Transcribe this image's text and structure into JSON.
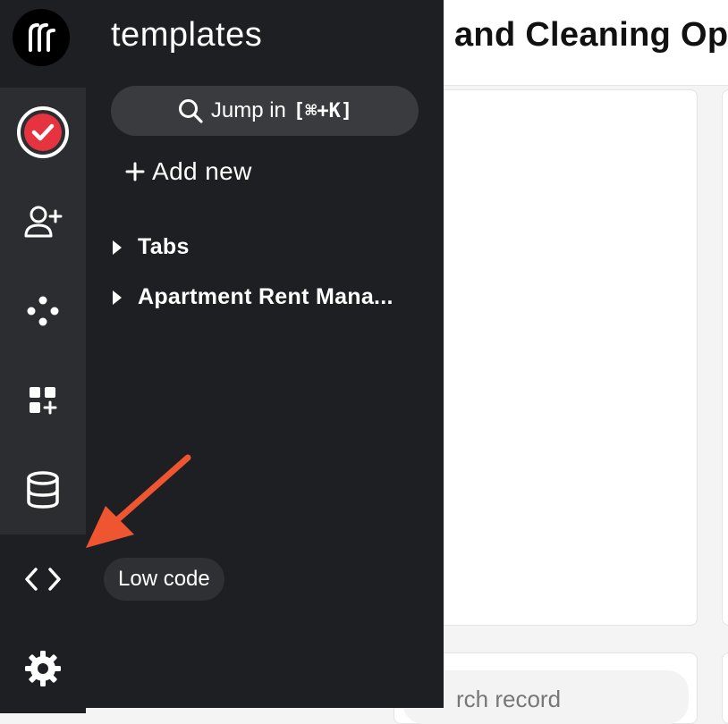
{
  "main": {
    "title": "and Cleaning Op",
    "search_placeholder": "rch record"
  },
  "rail": {
    "logo_icon": "logo-icon",
    "items": [
      {
        "name": "tasks",
        "icon": "check-circle-icon"
      },
      {
        "name": "invite-user",
        "icon": "user-plus-icon"
      },
      {
        "name": "integrations",
        "icon": "nodes-icon"
      },
      {
        "name": "apps",
        "icon": "apps-add-icon"
      },
      {
        "name": "database",
        "icon": "database-icon"
      },
      {
        "name": "low-code",
        "icon": "code-icon"
      },
      {
        "name": "settings",
        "icon": "gear-icon"
      }
    ],
    "accent": "#e5333f"
  },
  "panel": {
    "title": "templates",
    "jump_label": "Jump in",
    "jump_shortcut": "[⌘+K]",
    "add_new_label": "Add new",
    "tree": [
      {
        "label": "Tabs"
      },
      {
        "label": "Apartment Rent Mana..."
      }
    ]
  },
  "tooltip": {
    "text": "Low code"
  },
  "annotation": {
    "arrow_color": "#ee5530"
  }
}
